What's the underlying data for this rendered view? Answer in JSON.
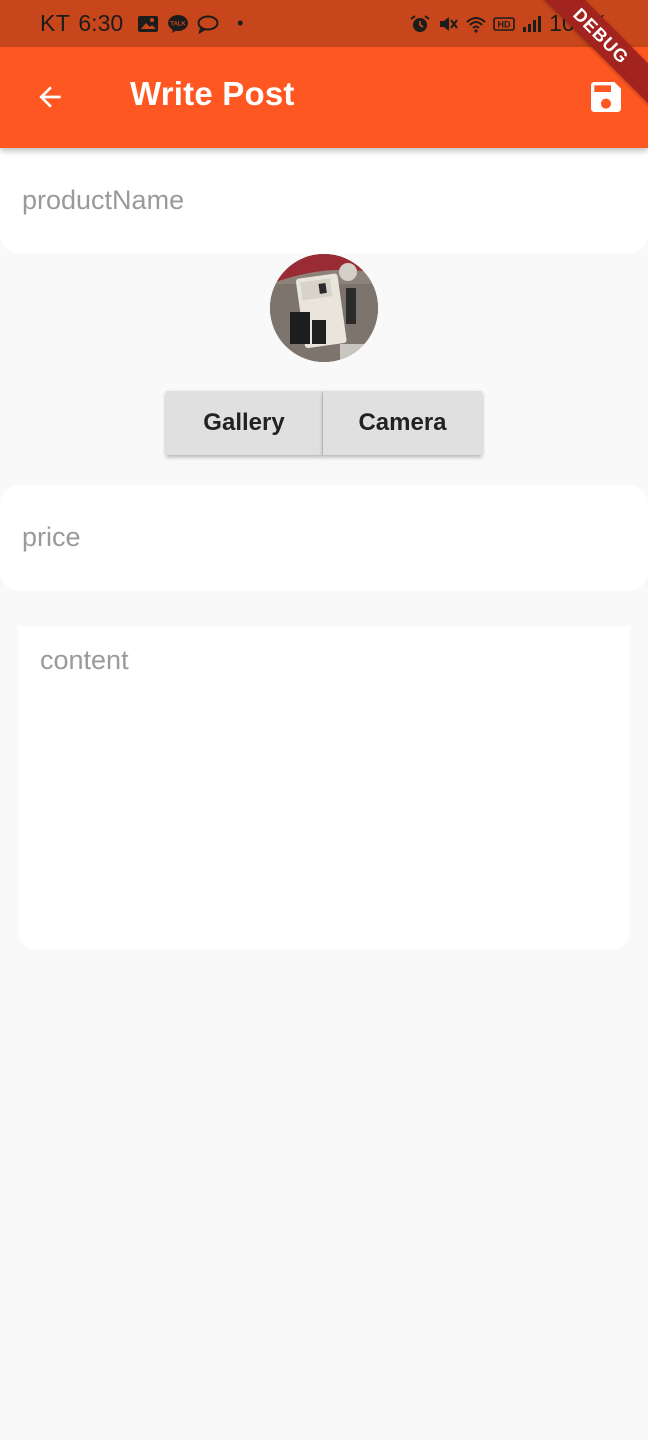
{
  "status_bar": {
    "carrier": "KT",
    "time": "6:30",
    "left_icons": [
      "image-icon",
      "kakaotalk-icon",
      "message-icon"
    ],
    "dot": "•",
    "right_icons": [
      "alarm-icon",
      "mute-icon",
      "wifi-icon",
      "hd-icon",
      "signal-icon"
    ],
    "battery": "100%"
  },
  "app_bar": {
    "title": "Write Post",
    "back_icon": "arrow-back-icon",
    "save_icon": "save-icon",
    "color": "#fe5722"
  },
  "debug_ribbon": "DEBUG",
  "form": {
    "product_name": {
      "value": "",
      "placeholder": "productName"
    },
    "price": {
      "value": "",
      "placeholder": "price"
    },
    "content": {
      "value": "",
      "placeholder": "content"
    }
  },
  "photo": {
    "description": "product-photo"
  },
  "buttons": {
    "gallery": "Gallery",
    "camera": "Camera"
  }
}
